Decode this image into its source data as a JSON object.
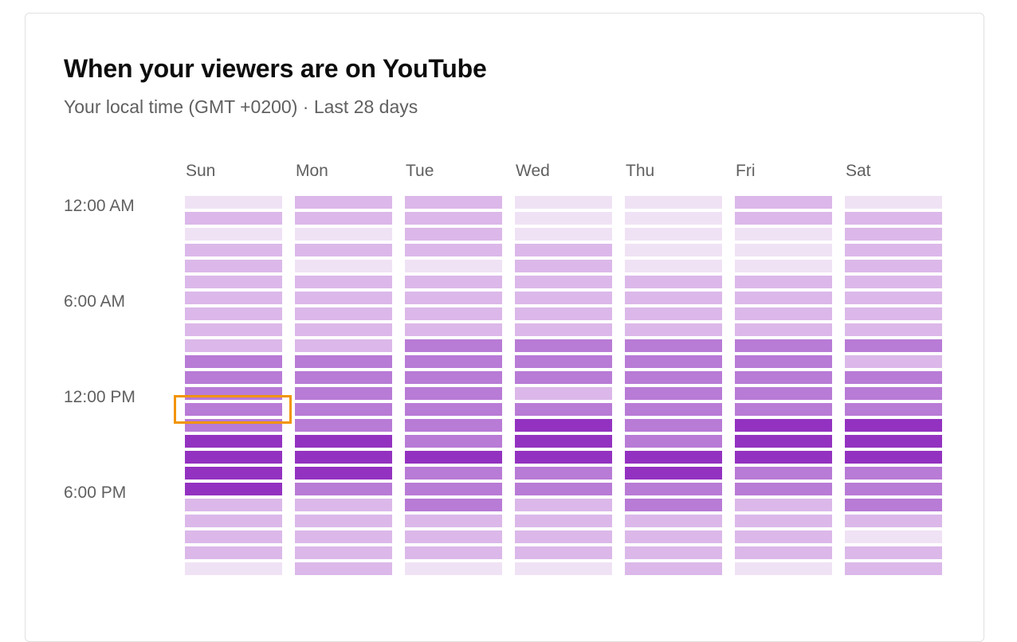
{
  "card": {
    "title": "When your viewers are on YouTube",
    "subtitle": "Your local time (GMT +0200) · Last 28 days"
  },
  "colors": {
    "levels": [
      "#f0e2f5",
      "#dbb8e9",
      "#b87bd6",
      "#9332c0"
    ],
    "highlight": "#f29400"
  },
  "chart_data": {
    "type": "heatmap",
    "title": "When your viewers are on YouTube",
    "subtitle": "Your local time (GMT +0200) · Last 28 days",
    "x_categories": [
      "Sun",
      "Mon",
      "Tue",
      "Wed",
      "Thu",
      "Fri",
      "Sat"
    ],
    "y_categories": [
      "12 AM",
      "1 AM",
      "2 AM",
      "3 AM",
      "4 AM",
      "5 AM",
      "6 AM",
      "7 AM",
      "8 AM",
      "9 AM",
      "10 AM",
      "11 AM",
      "12 PM",
      "1 PM",
      "2 PM",
      "3 PM",
      "4 PM",
      "5 PM",
      "6 PM",
      "7 PM",
      "8 PM",
      "9 PM",
      "10 PM",
      "11 PM"
    ],
    "y_tick_labels": [
      {
        "hour": 0,
        "label": "12:00 AM"
      },
      {
        "hour": 6,
        "label": "6:00 AM"
      },
      {
        "hour": 12,
        "label": "12:00 PM"
      },
      {
        "hour": 18,
        "label": "6:00 PM"
      }
    ],
    "value_scale": "intensity level 1 (lowest) to 4 (highest)",
    "values": {
      "Sun": [
        1,
        2,
        1,
        2,
        2,
        2,
        2,
        2,
        2,
        2,
        3,
        3,
        3,
        3,
        3,
        4,
        4,
        4,
        4,
        2,
        2,
        2,
        2,
        1
      ],
      "Mon": [
        2,
        2,
        1,
        2,
        1,
        2,
        2,
        2,
        2,
        2,
        3,
        3,
        3,
        3,
        3,
        4,
        4,
        4,
        3,
        2,
        2,
        2,
        2,
        2
      ],
      "Tue": [
        2,
        2,
        2,
        2,
        1,
        2,
        2,
        2,
        2,
        3,
        3,
        3,
        3,
        3,
        3,
        3,
        4,
        3,
        3,
        3,
        2,
        2,
        2,
        1
      ],
      "Wed": [
        1,
        1,
        1,
        2,
        2,
        2,
        2,
        2,
        2,
        3,
        3,
        3,
        2,
        3,
        4,
        4,
        4,
        3,
        3,
        2,
        2,
        2,
        2,
        1
      ],
      "Thu": [
        1,
        1,
        1,
        1,
        1,
        2,
        2,
        2,
        2,
        3,
        3,
        3,
        3,
        3,
        3,
        3,
        4,
        4,
        3,
        3,
        2,
        2,
        2,
        2
      ],
      "Fri": [
        2,
        2,
        1,
        1,
        1,
        2,
        2,
        2,
        2,
        3,
        3,
        3,
        3,
        3,
        4,
        4,
        4,
        3,
        3,
        2,
        2,
        2,
        2,
        1
      ],
      "Sat": [
        1,
        2,
        2,
        2,
        2,
        2,
        2,
        2,
        2,
        3,
        2,
        3,
        3,
        3,
        4,
        4,
        4,
        3,
        3,
        3,
        2,
        1,
        2,
        2
      ]
    },
    "highlighted_cell": {
      "day": "Sun",
      "hour": "1 PM"
    },
    "legend": "none"
  }
}
